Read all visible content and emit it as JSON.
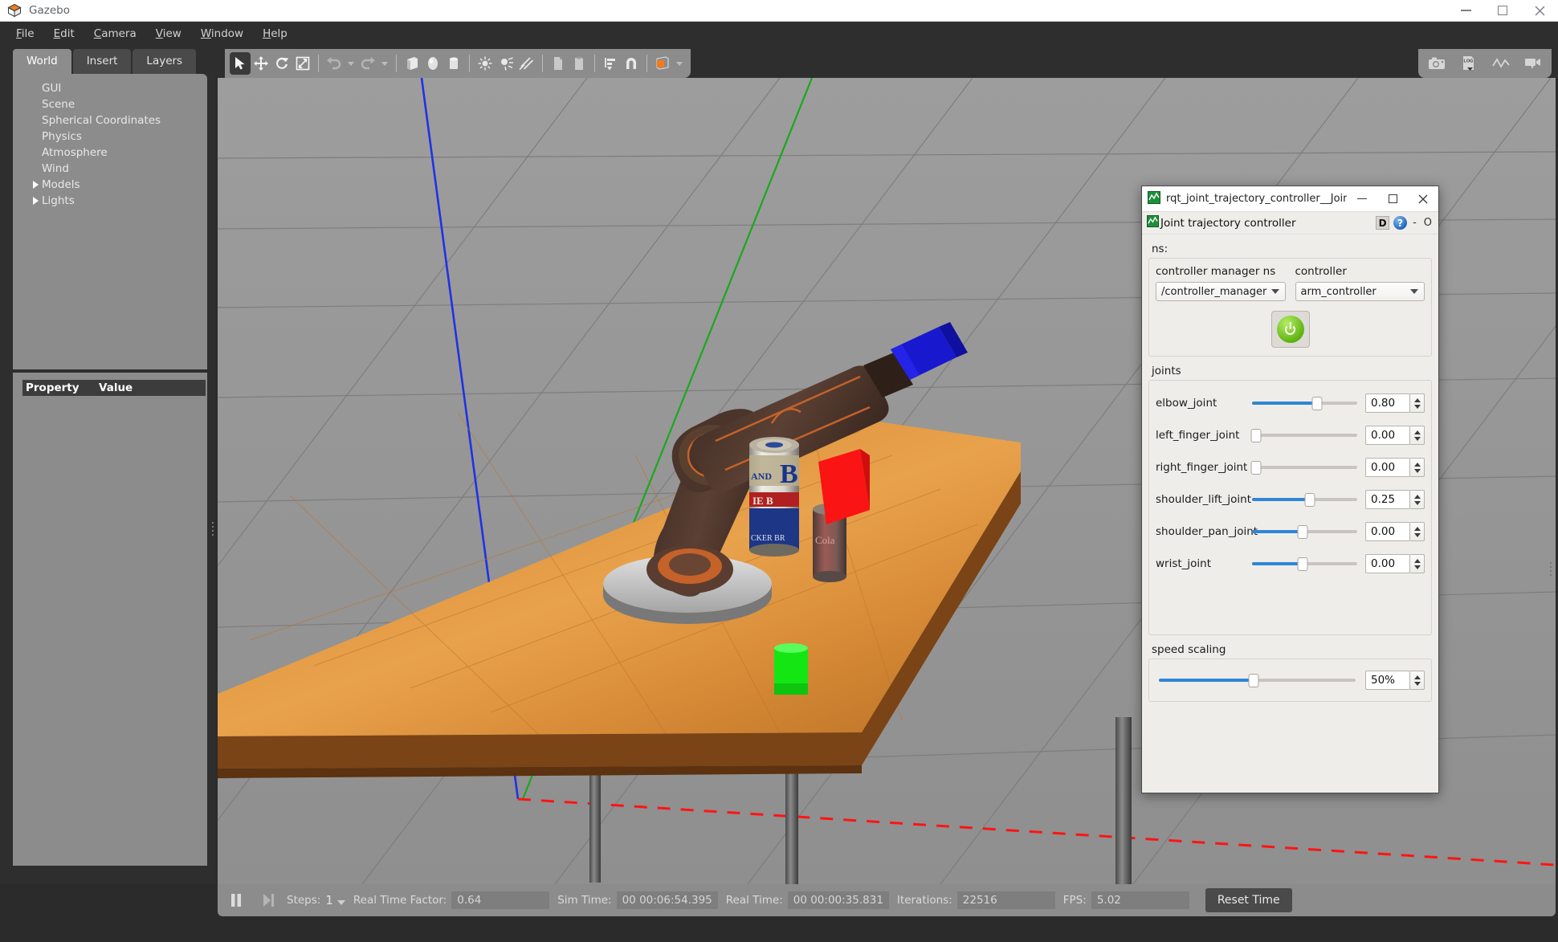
{
  "window": {
    "title": "Gazebo",
    "app_icon": "gazebo-icon",
    "controls": {
      "minimize": "–",
      "maximize": "□",
      "close": "✕"
    }
  },
  "menubar": [
    {
      "label": "File",
      "mnemonic": "F"
    },
    {
      "label": "Edit",
      "mnemonic": "E"
    },
    {
      "label": "Camera",
      "mnemonic": "C"
    },
    {
      "label": "View",
      "mnemonic": "V"
    },
    {
      "label": "Window",
      "mnemonic": "W"
    },
    {
      "label": "Help",
      "mnemonic": "H"
    }
  ],
  "left_panel": {
    "tabs": [
      {
        "label": "World",
        "active": true
      },
      {
        "label": "Insert",
        "active": false
      },
      {
        "label": "Layers",
        "active": false
      }
    ],
    "tree": [
      {
        "label": "GUI",
        "expandable": false
      },
      {
        "label": "Scene",
        "expandable": false
      },
      {
        "label": "Spherical Coordinates",
        "expandable": false
      },
      {
        "label": "Physics",
        "expandable": false
      },
      {
        "label": "Atmosphere",
        "expandable": false
      },
      {
        "label": "Wind",
        "expandable": false
      },
      {
        "label": "Models",
        "expandable": true
      },
      {
        "label": "Lights",
        "expandable": true
      }
    ],
    "property_table": {
      "columns": [
        "Property",
        "Value"
      ],
      "rows": []
    }
  },
  "toolbar": {
    "left_tools": [
      {
        "name": "select-mode-icon",
        "selected": true
      },
      {
        "name": "translate-mode-icon",
        "selected": false
      },
      {
        "name": "rotate-mode-icon",
        "selected": false
      },
      {
        "name": "scale-mode-icon",
        "selected": false
      },
      {
        "sep": true
      },
      {
        "name": "undo-icon",
        "selected": false
      },
      {
        "name": "undo-dropdown-icon",
        "selected": false
      },
      {
        "name": "redo-icon",
        "selected": false
      },
      {
        "name": "redo-dropdown-icon",
        "selected": false
      },
      {
        "sep": true
      },
      {
        "name": "insert-box-icon",
        "selected": false
      },
      {
        "name": "insert-sphere-icon",
        "selected": false
      },
      {
        "name": "insert-cylinder-icon",
        "selected": false
      },
      {
        "sep": true
      },
      {
        "name": "point-light-icon",
        "selected": false
      },
      {
        "name": "spot-light-icon",
        "selected": false
      },
      {
        "name": "directional-light-icon",
        "selected": false
      },
      {
        "sep": true
      },
      {
        "name": "copy-icon",
        "selected": false
      },
      {
        "name": "paste-icon",
        "selected": false
      },
      {
        "sep": true
      },
      {
        "name": "align-icon",
        "selected": false
      },
      {
        "name": "snap-icon",
        "selected": false
      },
      {
        "sep": true
      },
      {
        "name": "view-angle-icon",
        "selected": false
      }
    ],
    "right_tools": [
      {
        "name": "screenshot-icon"
      },
      {
        "name": "log-record-icon"
      },
      {
        "name": "plot-icon"
      },
      {
        "name": "video-record-icon"
      }
    ]
  },
  "statusbar": {
    "pause_icon": "pause-icon",
    "step_icon": "step-forward-icon",
    "steps_label": "Steps:",
    "steps_value": "1",
    "fields": [
      {
        "label": "Real Time Factor:",
        "value": "0.64",
        "name": "real-time-factor"
      },
      {
        "label": "Sim Time:",
        "value": "00 00:06:54.395",
        "name": "sim-time"
      },
      {
        "label": "Real Time:",
        "value": "00 00:00:35.831",
        "name": "real-time"
      },
      {
        "label": "Iterations:",
        "value": "22516",
        "name": "iterations"
      },
      {
        "label": "FPS:",
        "value": "5.02",
        "name": "fps"
      }
    ],
    "reset_button": "Reset Time"
  },
  "rqt_dialog": {
    "titlebar": {
      "icon": "rqt-plot-icon",
      "title": "rqt_joint_trajectory_controller__Joint...",
      "minimize": "–",
      "maximize": "□",
      "close": "✕"
    },
    "subheader": {
      "icon": "rqt-plot-icon",
      "title": "Joint trajectory controller",
      "dock_label": "D",
      "help_label": "?",
      "minus": "-",
      "close_o": "O"
    },
    "ns": {
      "group_label": "ns:",
      "manager": {
        "caption": "controller manager ns",
        "value": "/controller_manager"
      },
      "controller": {
        "caption": "controller",
        "value": "arm_controller"
      },
      "power_button": "power-on-button"
    },
    "joints": {
      "group_label": "joints",
      "items": [
        {
          "name": "elbow_joint",
          "value": "0.80",
          "fill_pct": 62,
          "handle_pct": 62
        },
        {
          "name": "left_finger_joint",
          "value": "0.00",
          "fill_pct": 0,
          "handle_pct": 3
        },
        {
          "name": "right_finger_joint",
          "value": "0.00",
          "fill_pct": 0,
          "handle_pct": 3
        },
        {
          "name": "shoulder_lift_joint",
          "value": "0.25",
          "fill_pct": 55,
          "handle_pct": 55
        },
        {
          "name": "shoulder_pan_joint",
          "value": "0.00",
          "fill_pct": 48,
          "handle_pct": 48
        },
        {
          "name": "wrist_joint",
          "value": "0.00",
          "fill_pct": 48,
          "handle_pct": 48
        }
      ]
    },
    "speed_scaling": {
      "group_label": "speed scaling",
      "value": "50%",
      "fill_pct": 48,
      "handle_pct": 48
    }
  },
  "scene": {
    "colors": {
      "sky": "#9a9a9a",
      "grid_line": "#7e7e7e",
      "table_top": "#d0812f",
      "table_edge": "#6b3f16",
      "robot_body": "#4a342b",
      "robot_accent": "#c4622a",
      "robot_base": "#c8c8c8",
      "gripper_blue": "#1414c8",
      "cube_red": "#fa1414",
      "cube_green": "#14e614",
      "axis_x": "#19c81e",
      "axis_z": "#1e32e6",
      "dashed_line": "#ff1414"
    },
    "objects": [
      {
        "name": "robot-arm",
        "label": "articulated robot arm"
      },
      {
        "name": "beer-can",
        "label": "beer can model"
      },
      {
        "name": "coke-can",
        "label": "coke can model"
      },
      {
        "name": "red-cube",
        "label": "red box"
      },
      {
        "name": "green-cube",
        "label": "green box"
      },
      {
        "name": "table",
        "label": "wooden table"
      }
    ]
  }
}
